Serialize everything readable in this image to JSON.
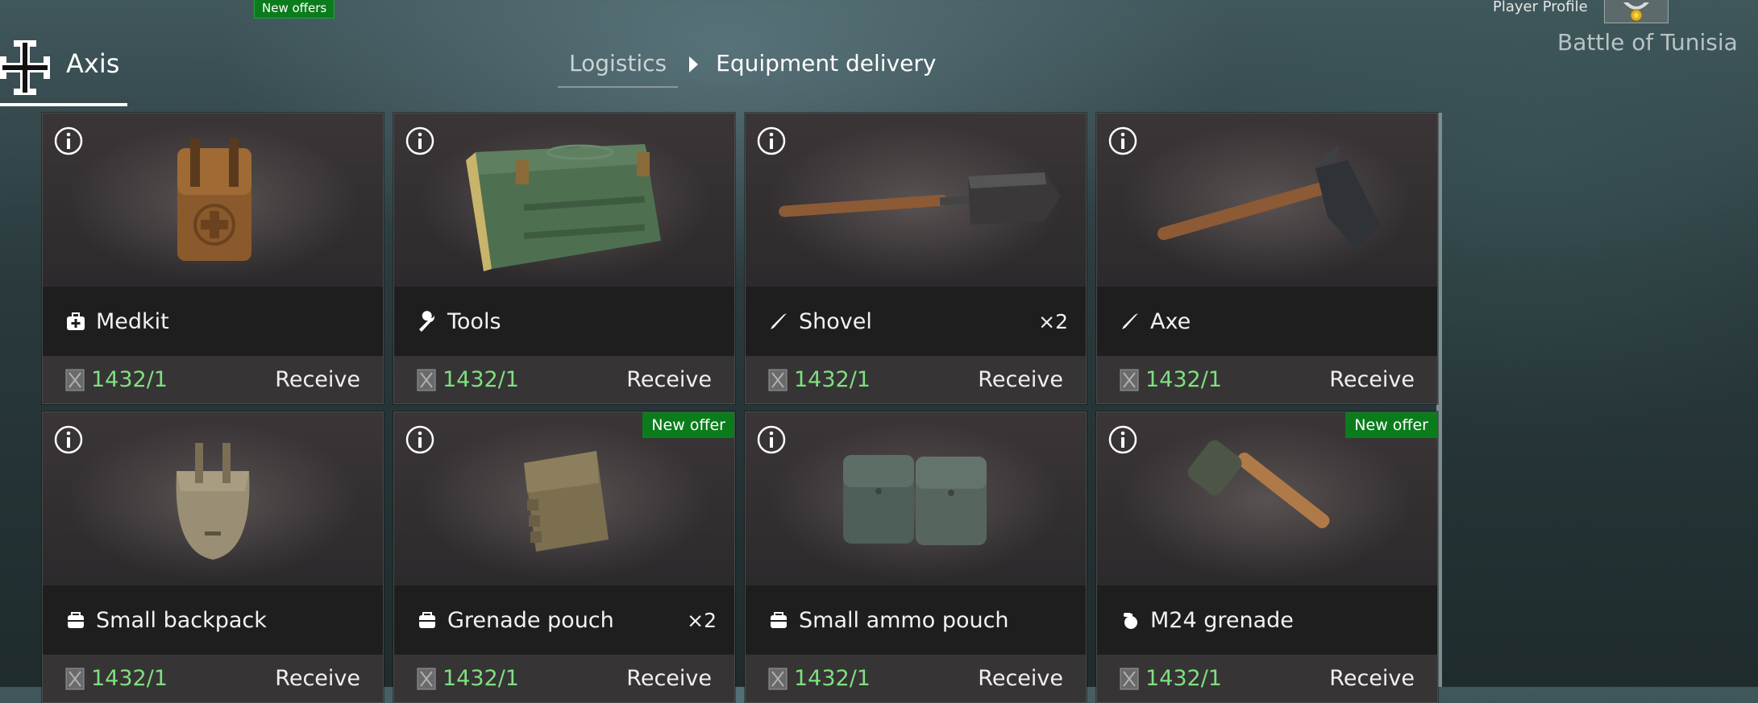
{
  "header": {
    "new_offers": "New offers",
    "player_profile": "Player Profile",
    "battle": "Battle of Tunisia",
    "faction": "Axis"
  },
  "breadcrumb": {
    "parent": "Logistics",
    "current": "Equipment delivery"
  },
  "colors": {
    "offer_badge": "#0b7c1c",
    "cost_text": "#7ee07e",
    "card_bg": "#2f2c2d"
  },
  "items": [
    {
      "name": "Medkit",
      "icon": "medkit-icon",
      "qty": "",
      "cost": "1432/1",
      "action": "Receive",
      "badge": ""
    },
    {
      "name": "Tools",
      "icon": "wrench-icon",
      "qty": "",
      "cost": "1432/1",
      "action": "Receive",
      "badge": ""
    },
    {
      "name": "Shovel",
      "icon": "blade-icon",
      "qty": "×2",
      "cost": "1432/1",
      "action": "Receive",
      "badge": ""
    },
    {
      "name": "Axe",
      "icon": "blade-icon",
      "qty": "",
      "cost": "1432/1",
      "action": "Receive",
      "badge": ""
    },
    {
      "name": "Small backpack",
      "icon": "bag-icon",
      "qty": "",
      "cost": "1432/1",
      "action": "Receive",
      "badge": ""
    },
    {
      "name": "Grenade pouch",
      "icon": "bag-icon",
      "qty": "×2",
      "cost": "1432/1",
      "action": "Receive",
      "badge": "New offer"
    },
    {
      "name": "Small ammo pouch",
      "icon": "bag-icon",
      "qty": "",
      "cost": "1432/1",
      "action": "Receive",
      "badge": ""
    },
    {
      "name": "M24 grenade",
      "icon": "grenade-icon",
      "qty": "",
      "cost": "1432/1",
      "action": "Receive",
      "badge": "New offer"
    }
  ]
}
